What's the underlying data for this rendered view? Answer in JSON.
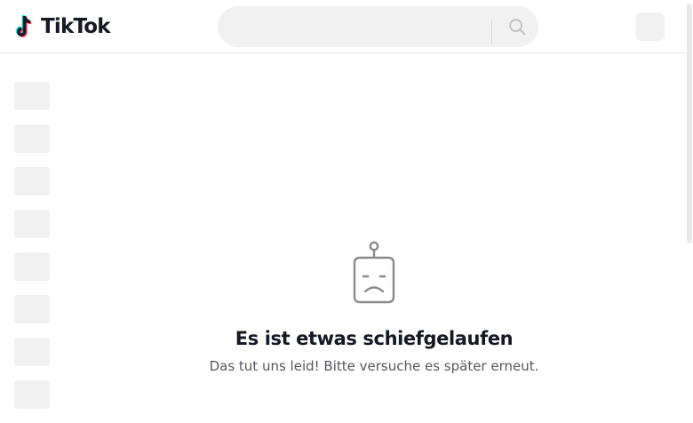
{
  "header": {
    "logo_text": "TikTok",
    "search": {
      "placeholder": "",
      "value": ""
    },
    "icons": {
      "logo": "tiktok-note-icon",
      "search": "search-icon"
    }
  },
  "sidebar": {
    "skeleton_count": 8
  },
  "error": {
    "icon": "sad-robot-icon",
    "title": "Es ist etwas schiefgelaufen",
    "message": "Das tut uns leid! Bitte versuche es später erneut."
  },
  "colors": {
    "text_primary": "#161823",
    "text_secondary": "#56575e",
    "surface": "#f1f1f2",
    "logo_cyan": "#25f4ee",
    "logo_red": "#fe2c55"
  }
}
